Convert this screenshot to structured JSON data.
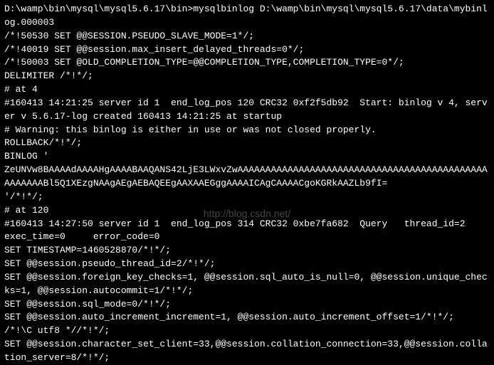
{
  "watermark": "http://blog.csdn.net/",
  "lines": [
    "D:\\wamp\\bin\\mysql\\mysql5.6.17\\bin>mysqlbinlog D:\\wamp\\bin\\mysql\\mysql5.6.17\\data\\mybinlog.000003",
    "/*!50530 SET @@SESSION.PSEUDO_SLAVE_MODE=1*/;",
    "/*!40019 SET @@session.max_insert_delayed_threads=0*/;",
    "/*!50003 SET @OLD_COMPLETION_TYPE=@@COMPLETION_TYPE,COMPLETION_TYPE=0*/;",
    "DELIMITER /*!*/;",
    "# at 4",
    "#160413 14:21:25 server id 1  end_log_pos 120 CRC32 0xf2f5db92  Start: binlog v 4, server v 5.6.17-log created 160413 14:21:25 at startup",
    "# Warning: this binlog is either in use or was not closed properly.",
    "ROLLBACK/*!*/;",
    "BINLOG '",
    "ZeUNVw8BAAAAdAAAAHgAAAABAAQANS42LjE3LWxvZwAAAAAAAAAAAAAAAAAAAAAAAAAAAAAAAAAAAAAAAAAAAAAAAAAAAABl5Q1XEzgNAAgAEgAEBAQEEgAAXAAEGggAAAAICAgCAAAACgoKGRkAAZLb9fI=",
    "'/*!*/;",
    "# at 120",
    "#160413 14:27:50 server id 1  end_log_pos 314 CRC32 0xbe7fa682  Query   thread_id=2     exec_time=0     error_code=0",
    "SET TIMESTAMP=1460528870/*!*/;",
    "SET @@session.pseudo_thread_id=2/*!*/;",
    "SET @@session.foreign_key_checks=1, @@session.sql_auto_is_null=0, @@session.unique_checks=1, @@session.autocommit=1/*!*/;",
    "SET @@session.sql_mode=0/*!*/;",
    "SET @@session.auto_increment_increment=1, @@session.auto_increment_offset=1/*!*/;",
    "/*!\\C utf8 *//*!*/;",
    "SET @@session.character_set_client=33,@@session.collation_connection=33,@@session.collation_server=8/*!*/;"
  ]
}
